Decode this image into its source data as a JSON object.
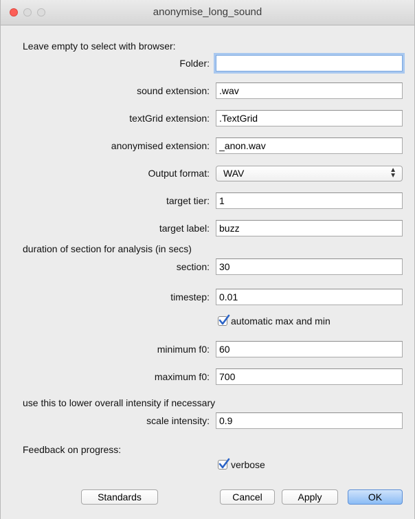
{
  "window": {
    "title": "anonymise_long_sound"
  },
  "sections": {
    "browser_note": "Leave empty to select with browser:",
    "duration_note": "duration of section for analysis (in secs)",
    "intensity_note": "use this to lower overall intensity if necessary",
    "feedback_note": "Feedback on progress:"
  },
  "fields": {
    "folder": {
      "label": "Folder:",
      "value": ""
    },
    "sound_extension": {
      "label": "sound extension:",
      "value": ".wav"
    },
    "textgrid_extension": {
      "label": "textGrid extension:",
      "value": ".TextGrid"
    },
    "anonymised_extension": {
      "label": "anonymised extension:",
      "value": "_anon.wav"
    },
    "output_format": {
      "label": "Output format:",
      "value": "WAV"
    },
    "target_tier": {
      "label": "target tier:",
      "value": "1"
    },
    "target_label": {
      "label": "target label:",
      "value": "buzz"
    },
    "section": {
      "label": "section:",
      "value": "30"
    },
    "timestep": {
      "label": "timestep:",
      "value": "0.01"
    },
    "minimum_f0": {
      "label": "minimum f0:",
      "value": "60"
    },
    "maximum_f0": {
      "label": "maximum f0:",
      "value": "700"
    },
    "scale_intensity": {
      "label": "scale intensity:",
      "value": "0.9"
    }
  },
  "checkboxes": {
    "automatic_max_min": {
      "label": "automatic max and min",
      "checked": true
    },
    "verbose": {
      "label": "verbose",
      "checked": true
    }
  },
  "buttons": {
    "standards": "Standards",
    "cancel": "Cancel",
    "apply": "Apply",
    "ok": "OK"
  },
  "colors": {
    "default_button": "#8bbcf5",
    "check_accent": "#2b63c6",
    "focus_ring": "#a9c8ef"
  }
}
